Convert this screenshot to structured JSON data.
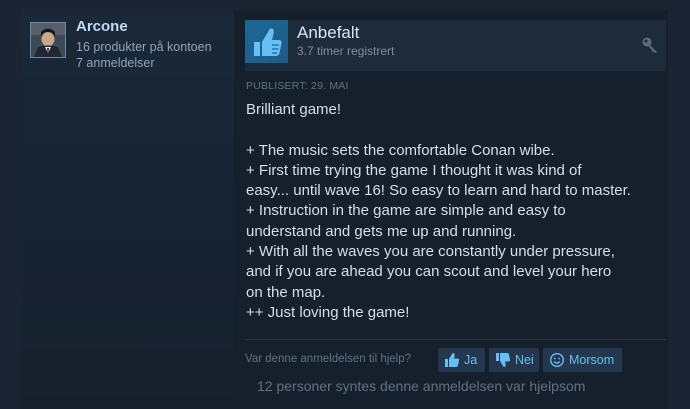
{
  "author": {
    "name": "Arcone",
    "products": "16 produkter på kontoen",
    "reviews": "7 anmeldelser",
    "avatar_icon": "user-avatar"
  },
  "review": {
    "verdict": "Anbefalt",
    "verdict_icon": "thumbs-up-icon",
    "hours": "3.7 timer registrert",
    "key_icon": "key-icon",
    "posted": "PUBLISERT: 29. MAI",
    "lines": [
      "Brilliant game!",
      "",
      "+ The music sets the comfortable Conan wibe.",
      "+ First time trying the game I thought it was kind of",
      "easy... until wave 16! So easy to learn and hard to master.",
      "+ Instruction in the game are simple and easy to",
      "understand and gets me up and running.",
      "+ With all the waves you are constantly under pressure,",
      "and if you are ahead you can scout and level your hero",
      "on the map.",
      "++ Just loving the game!"
    ]
  },
  "helpful": {
    "question": "Var denne anmeldelsen til hjelp?",
    "yes_label": "Ja",
    "no_label": "Nei",
    "funny_label": "Morsom",
    "count_text": "12 personer syntes denne anmeldelsen var hjelpsom"
  },
  "colors": {
    "background": "#1a2432",
    "accent": "#66c0f4",
    "verdict_tile": "#1b6796",
    "button_bg": "#24374d"
  }
}
